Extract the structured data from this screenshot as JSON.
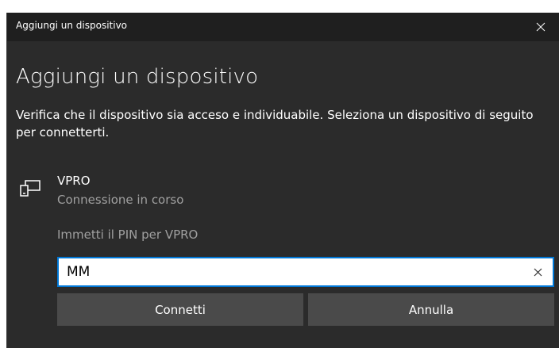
{
  "window": {
    "title": "Aggiungi un dispositivo"
  },
  "main": {
    "heading": "Aggiungi un dispositivo",
    "description": "Verifica che il dispositivo sia acceso e individuabile. Seleziona un dispositivo di seguito per connetterti."
  },
  "device": {
    "icon": "device-icon",
    "name": "VPRO",
    "status": "Connessione in corso",
    "pin_prompt": "Immetti il PIN per VPRO"
  },
  "pin_input": {
    "value": "MM",
    "clear_icon": "clear-icon"
  },
  "buttons": {
    "connect_label": "Connetti",
    "cancel_label": "Annulla"
  },
  "colors": {
    "window_bg": "#2b2b2b",
    "titlebar_bg": "#1f1f1f",
    "accent": "#0078d7",
    "button_bg": "#4a4a4a",
    "secondary_text": "#a0a0a0"
  }
}
